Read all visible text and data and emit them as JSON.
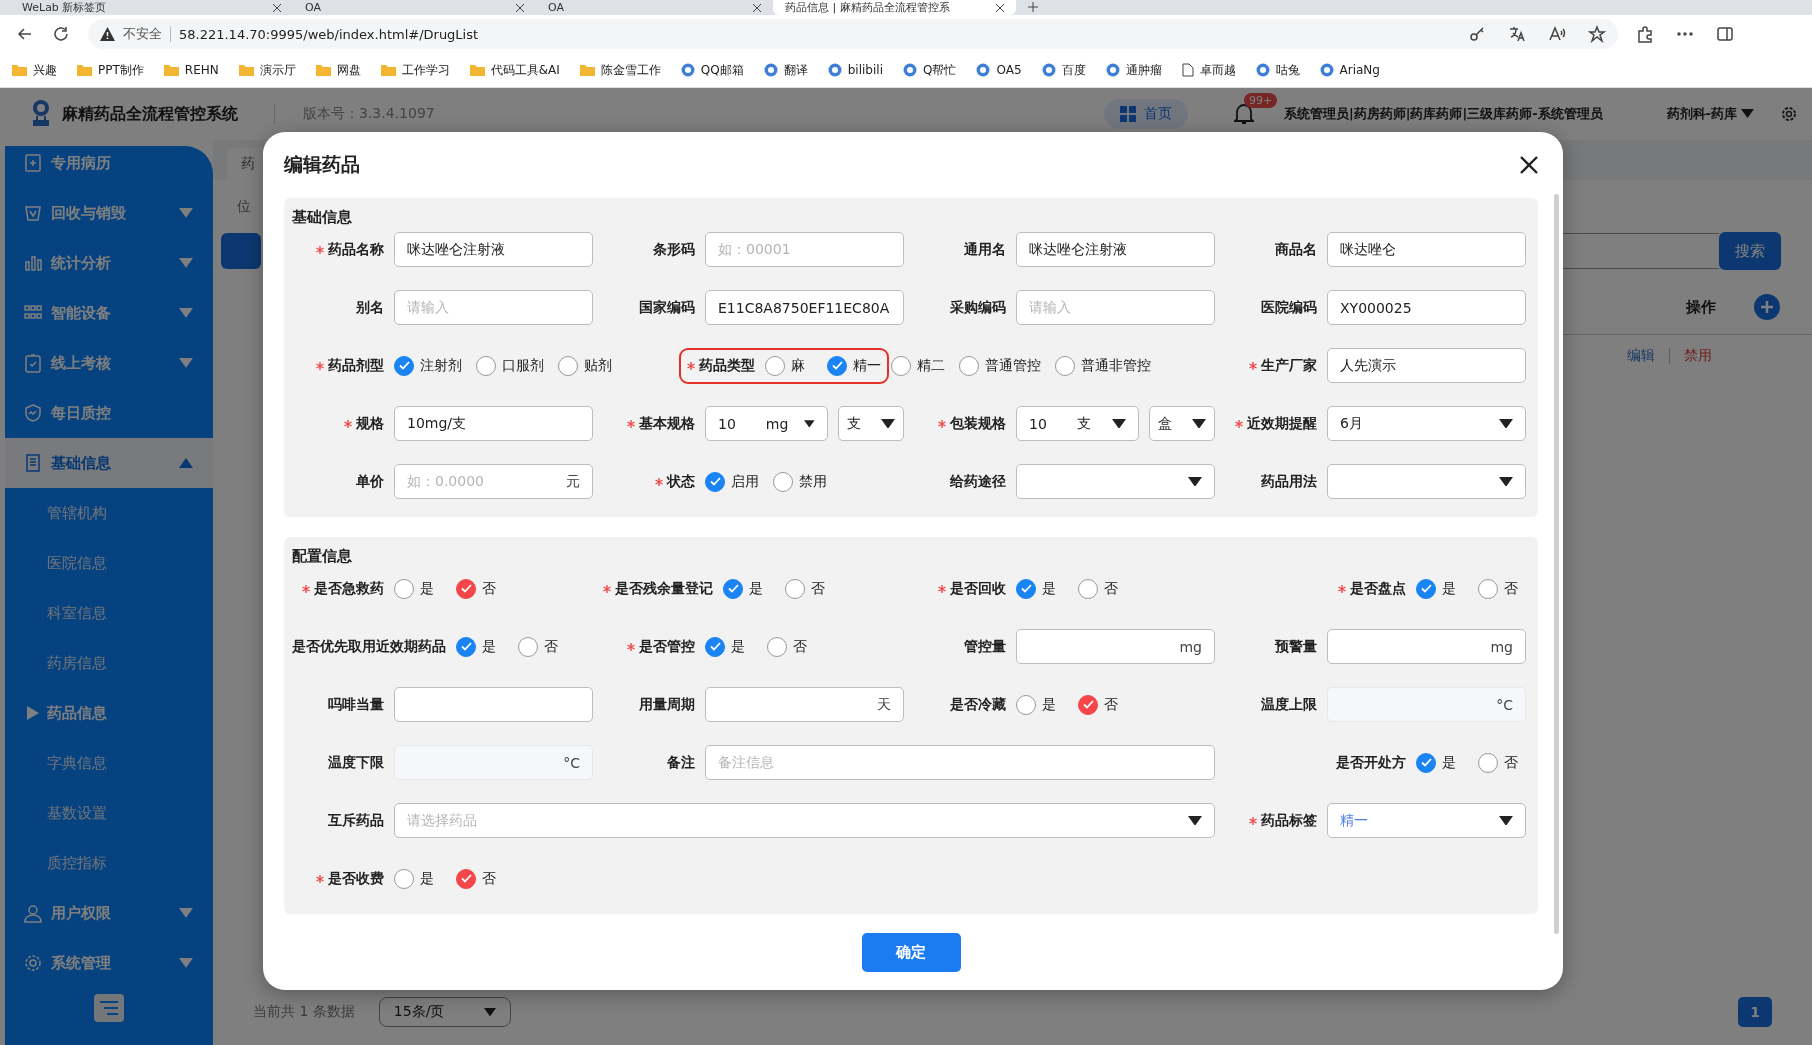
{
  "browser": {
    "tabs": [
      {
        "title": "WeLab 新标签页",
        "selected": false
      },
      {
        "title": "OA",
        "selected": false
      },
      {
        "title": "OA",
        "selected": false
      },
      {
        "title": "药品信息 | 麻精药品全流程管控系",
        "selected": true
      }
    ],
    "security": "不安全",
    "url": "58.221.14.70:9995/web/index.html#/DrugList",
    "bookmarks": [
      {
        "label": "兴趣",
        "kind": "folder"
      },
      {
        "label": "PPT制作",
        "kind": "folder"
      },
      {
        "label": "REHN",
        "kind": "folder"
      },
      {
        "label": "演示厅",
        "kind": "folder"
      },
      {
        "label": "网盘",
        "kind": "folder"
      },
      {
        "label": "工作学习",
        "kind": "folder"
      },
      {
        "label": "代码工具&AI",
        "kind": "folder"
      },
      {
        "label": "陈金雪工作",
        "kind": "folder"
      },
      {
        "label": "QQ邮箱",
        "kind": "site"
      },
      {
        "label": "翻译",
        "kind": "site"
      },
      {
        "label": "bilibili",
        "kind": "site"
      },
      {
        "label": "Q帮忙",
        "kind": "site"
      },
      {
        "label": "OA5",
        "kind": "site"
      },
      {
        "label": "百度",
        "kind": "site"
      },
      {
        "label": "通肿瘤",
        "kind": "site"
      },
      {
        "label": "卓而越",
        "kind": "page"
      },
      {
        "label": "咕兔",
        "kind": "site"
      },
      {
        "label": "AriaNg",
        "kind": "site"
      }
    ]
  },
  "header": {
    "title": "麻精药品全流程管控系统",
    "version": "版本号：3.3.4.1097",
    "home": "首页",
    "badge": "99+",
    "roles": "系统管理员|药房药师|药库药师|三级库药师-系统管理员",
    "department": "药剂科-药库"
  },
  "sidebar": {
    "items": [
      {
        "label": "专用病历",
        "selected": false
      },
      {
        "label": "回收与销毁",
        "selected": false,
        "expanded": false
      },
      {
        "label": "统计分析",
        "selected": false,
        "expanded": false
      },
      {
        "label": "智能设备",
        "selected": false,
        "expanded": false
      },
      {
        "label": "线上考核",
        "selected": false,
        "expanded": false
      },
      {
        "label": "每日质控",
        "selected": false
      },
      {
        "label": "基础信息",
        "selected": true,
        "expanded": true,
        "children": [
          {
            "label": "管辖机构",
            "selected": false
          },
          {
            "label": "医院信息",
            "selected": false
          },
          {
            "label": "科室信息",
            "selected": false
          },
          {
            "label": "药房信息",
            "selected": false
          },
          {
            "label": "药品信息",
            "selected": true
          },
          {
            "label": "字典信息",
            "selected": false
          },
          {
            "label": "基数设置",
            "selected": false
          },
          {
            "label": "质控指标",
            "selected": false
          }
        ]
      },
      {
        "label": "用户权限",
        "selected": false,
        "expanded": false
      },
      {
        "label": "系统管理",
        "selected": false,
        "expanded": false
      }
    ]
  },
  "main": {
    "tab": "药",
    "breadcrumb": "位",
    "search_button": "搜索",
    "table": {
      "columns": [
        "操作"
      ],
      "rows": [
        {
          "actions": [
            {
              "label": "编辑",
              "kind": "primary"
            },
            {
              "label": "禁用",
              "kind": "danger"
            }
          ]
        }
      ]
    },
    "pagination": {
      "summary": "当前共 1 条数据",
      "page_size": "15条/页",
      "pages": [
        {
          "label": "1",
          "selected": true
        }
      ]
    }
  },
  "dialog": {
    "title": "编辑药品",
    "confirm": "确定",
    "sections": [
      {
        "title": "基础信息",
        "rows": [
          [
            {
              "label": "药品名称",
              "required": true,
              "kind": "text",
              "value": "咪达唑仑注射液",
              "disabled": false
            },
            {
              "label": "条形码",
              "required": false,
              "kind": "text",
              "placeholder": "如：00001",
              "disabled": false
            },
            {
              "label": "通用名",
              "required": false,
              "kind": "text",
              "value": "咪达唑仑注射液",
              "disabled": false
            },
            {
              "label": "商品名",
              "required": false,
              "kind": "text",
              "value": "咪达唑仑",
              "disabled": false
            }
          ],
          [
            {
              "label": "别名",
              "required": false,
              "kind": "text",
              "placeholder": "请输入",
              "disabled": false
            },
            {
              "label": "国家编码",
              "required": false,
              "kind": "text",
              "value": "E11C8A8750EF11EC80A",
              "disabled": false
            },
            {
              "label": "采购编码",
              "required": false,
              "kind": "text",
              "placeholder": "请输入",
              "disabled": false
            },
            {
              "label": "医院编码",
              "required": false,
              "kind": "text",
              "value": "XY000025",
              "disabled": false
            }
          ],
          [
            {
              "label": "药品剂型",
              "required": true,
              "kind": "radio",
              "options": [
                {
                  "label": "注射剂",
                  "selected": true,
                  "color": "#1a84f5"
                },
                {
                  "label": "口服剂",
                  "selected": false
                },
                {
                  "label": "贴剂",
                  "selected": false
                }
              ]
            },
            {
              "label": "药品类型",
              "required": true,
              "kind": "radio",
              "highlighted": true,
              "options": [
                {
                  "label": "麻",
                  "selected": false,
                  "highlighted": true
                },
                {
                  "label": "精一",
                  "selected": true,
                  "color": "#1a84f5",
                  "highlighted": true
                },
                {
                  "label": "精二",
                  "selected": false,
                  "highlighted": false
                },
                {
                  "label": "普通管控",
                  "selected": false,
                  "highlighted": false
                },
                {
                  "label": "普通非管控",
                  "selected": false,
                  "highlighted": false
                }
              ]
            },
            "",
            {
              "label": "生产厂家",
              "required": true,
              "kind": "text",
              "value": "人先演示",
              "disabled": false
            }
          ],
          [
            {
              "label": "规格",
              "required": true,
              "kind": "text",
              "value": "10mg/支",
              "disabled": false
            },
            {
              "label": "基本规格",
              "required": true,
              "kind": "unit-select",
              "parts": [
                {
                  "value": "10",
                  "unit": "mg"
                },
                {
                  "value": "支"
                }
              ]
            },
            {
              "label": "包装规格",
              "required": true,
              "kind": "unit-select",
              "parts": [
                {
                  "value": "10",
                  "unit": "支"
                },
                {
                  "value": "盒"
                }
              ]
            },
            {
              "label": "近效期提醒",
              "required": true,
              "kind": "select",
              "value": "6月"
            }
          ],
          [
            {
              "label": "单价",
              "required": false,
              "kind": "text",
              "placeholder": "如：0.0000",
              "unit": "元",
              "disabled": false
            },
            {
              "label": "状态",
              "required": true,
              "kind": "radio",
              "options": [
                {
                  "label": "启用",
                  "selected": true,
                  "color": "#1a84f5"
                },
                {
                  "label": "禁用",
                  "selected": false
                }
              ]
            },
            {
              "label": "给药途径",
              "required": false,
              "kind": "select"
            },
            {
              "label": "药品用法",
              "required": false,
              "kind": "select"
            }
          ]
        ]
      },
      {
        "title": "配置信息",
        "rows": [
          [
            {
              "label": "是否急救药",
              "required": true,
              "kind": "radio",
              "options": [
                {
                  "label": "是",
                  "selected": false
                },
                {
                  "label": "否",
                  "selected": true,
                  "color": "#f5474a"
                }
              ]
            },
            {
              "label": "是否残余量登记",
              "required": true,
              "kind": "radio",
              "options": [
                {
                  "label": "是",
                  "selected": true,
                  "color": "#1a84f5"
                },
                {
                  "label": "否",
                  "selected": false
                }
              ]
            },
            {
              "label": "是否回收",
              "required": true,
              "kind": "radio",
              "options": [
                {
                  "label": "是",
                  "selected": true,
                  "color": "#1a84f5"
                },
                {
                  "label": "否",
                  "selected": false
                }
              ]
            },
            {
              "label": "是否盘点",
              "required": true,
              "kind": "radio",
              "options": [
                {
                  "label": "是",
                  "selected": true,
                  "color": "#1a84f5"
                },
                {
                  "label": "否",
                  "selected": false
                }
              ]
            }
          ],
          [
            {
              "label": "是否优先取用近效期药品",
              "required": false,
              "kind": "radio",
              "options": [
                {
                  "label": "是",
                  "selected": true,
                  "color": "#1a84f5"
                },
                {
                  "label": "否",
                  "selected": false
                }
              ]
            },
            {
              "label": "是否管控",
              "required": true,
              "kind": "radio",
              "options": [
                {
                  "label": "是",
                  "selected": true,
                  "color": "#1a84f5"
                },
                {
                  "label": "否",
                  "selected": false
                }
              ]
            },
            {
              "label": "管控量",
              "required": false,
              "kind": "text",
              "unit": "mg",
              "disabled": false
            },
            {
              "label": "预警量",
              "required": false,
              "kind": "text",
              "unit": "mg",
              "disabled": false
            }
          ],
          [
            {
              "label": "吗啡当量",
              "required": false,
              "kind": "text",
              "disabled": false
            },
            {
              "label": "用量周期",
              "required": false,
              "kind": "text",
              "unit": "天",
              "disabled": false
            },
            {
              "label": "是否冷藏",
              "required": false,
              "kind": "radio",
              "options": [
                {
                  "label": "是",
                  "selected": false
                },
                {
                  "label": "否",
                  "selected": true,
                  "color": "#f5474a"
                }
              ]
            },
            {
              "label": "温度上限",
              "required": false,
              "kind": "text",
              "unit": "°C",
              "disabled": true
            }
          ],
          [
            {
              "label": "温度下限",
              "required": false,
              "kind": "text",
              "unit": "°C",
              "disabled": true
            },
            {
              "label": "备注",
              "required": false,
              "kind": "text",
              "placeholder": "备注信息",
              "disabled": false
            },
            "",
            {
              "label": "是否开处方",
              "required": false,
              "kind": "radio",
              "options": [
                {
                  "label": "是",
                  "selected": true,
                  "color": "#1a84f5"
                },
                {
                  "label": "否",
                  "selected": false
                }
              ]
            }
          ],
          [
            {
              "label": "互斥药品",
              "required": false,
              "kind": "select",
              "placeholder": "请选择药品"
            },
            "",
            "",
            {
              "label": "药品标签",
              "required": true,
              "kind": "select",
              "value": "精一",
              "color": "#4a7ee8"
            }
          ],
          [
            {
              "label": "是否收费",
              "required": true,
              "kind": "radio",
              "options": [
                {
                  "label": "是",
                  "selected": false
                },
                {
                  "label": "否",
                  "selected": true,
                  "color": "#f5474a"
                }
              ]
            }
          ]
        ]
      }
    ]
  }
}
